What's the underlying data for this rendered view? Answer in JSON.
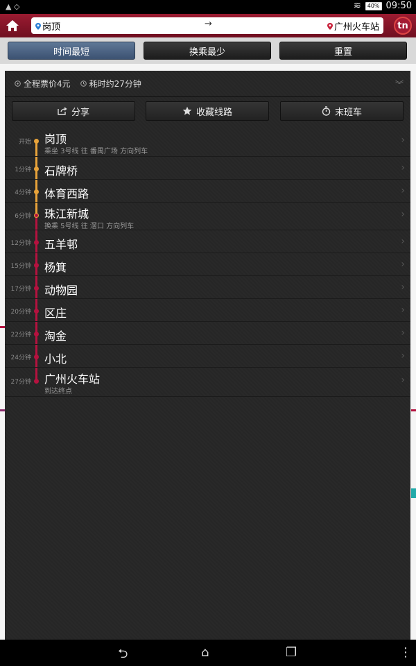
{
  "status": {
    "battery": "40%",
    "time": "09:50"
  },
  "topbar": {
    "from": "岗顶",
    "arrow": "→",
    "to": "广州火车站",
    "logo": "tn"
  },
  "tabs": [
    {
      "label": "时间最短",
      "active": true
    },
    {
      "label": "换乘最少",
      "active": false
    },
    {
      "label": "重置",
      "active": false
    }
  ],
  "summary": {
    "fare": "全程票价4元",
    "duration": "耗时约27分钟"
  },
  "actions": {
    "share": "分享",
    "favorite": "收藏线路",
    "last_train": "末班车"
  },
  "lines": {
    "line3_color": "#e8a33a",
    "line5_color": "#b5123f"
  },
  "stops": [
    {
      "time": "开始",
      "name": "岗顶",
      "sub": "乘坐 3号线 往 番禺广场 方向列车",
      "line": "line3"
    },
    {
      "time": "1分钟",
      "name": "石牌桥",
      "sub": "",
      "line": "line3"
    },
    {
      "time": "4分钟",
      "name": "体育西路",
      "sub": "",
      "line": "line3"
    },
    {
      "time": "6分钟",
      "name": "珠江新城",
      "sub": "换乘 5号线 往 滘口 方向列车",
      "line": "transfer"
    },
    {
      "time": "12分钟",
      "name": "五羊邨",
      "sub": "",
      "line": "line5"
    },
    {
      "time": "15分钟",
      "name": "杨箕",
      "sub": "",
      "line": "line5"
    },
    {
      "time": "17分钟",
      "name": "动物园",
      "sub": "",
      "line": "line5"
    },
    {
      "time": "20分钟",
      "name": "区庄",
      "sub": "",
      "line": "line5"
    },
    {
      "time": "22分钟",
      "name": "淘金",
      "sub": "",
      "line": "line5"
    },
    {
      "time": "24分钟",
      "name": "小北",
      "sub": "",
      "line": "line5"
    },
    {
      "time": "27分钟",
      "name": "广州火车站",
      "sub": "到达终点",
      "line": "line5"
    }
  ]
}
